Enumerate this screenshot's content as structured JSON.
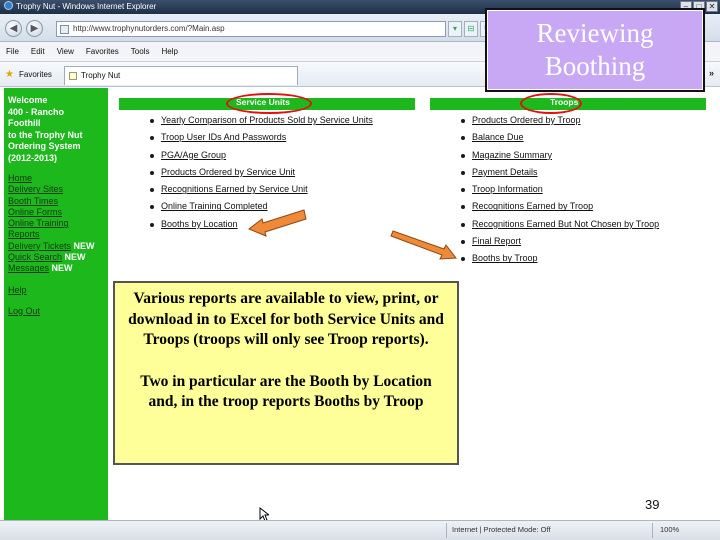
{
  "browser": {
    "window_title": "Trophy Nut - Windows Internet Explorer",
    "url": "http://www.trophynutorders.com/?Main.asp",
    "menu": [
      "File",
      "Edit",
      "View",
      "Favorites",
      "Tools",
      "Help"
    ],
    "favorites_label": "Favorites",
    "tab_title": "Trophy Nut",
    "status_zone": "Internet | Protected Mode: Off",
    "zoom": "100%"
  },
  "sidebar": {
    "welcome_lines": [
      "Welcome",
      "400 - Rancho",
      "Foothill",
      "to the Trophy Nut",
      "Ordering System",
      "(2012-2013)"
    ],
    "links": [
      "Home",
      "Delivery Sites",
      "Booth Times",
      "Online Forms",
      "Online Training",
      "Reports",
      "Delivery Tickets",
      "Quick Search",
      "Messages",
      "Help",
      "Log Out"
    ],
    "new_badge": "NEW"
  },
  "service_units": {
    "title": "Service Units",
    "reports": [
      "Yearly Comparison of Products Sold by Service Units",
      "Troop User IDs And Passwords",
      "PGA/Age Group",
      "Products Ordered by Service Unit",
      "Recognitions Earned by Service Unit",
      "Online Training Completed",
      "Booths by Location"
    ]
  },
  "troops": {
    "title": "Troops",
    "reports": [
      "Products Ordered by Troop",
      "Balance Due",
      "Magazine Summary",
      "Payment Details",
      "Troop Information",
      "Recognitions Earned by Troop",
      "Recognitions Earned But Not Chosen by Troop",
      "Final Report",
      "Booths by Troop"
    ]
  },
  "slide": {
    "title_line1": "Reviewing",
    "title_line2": "Boothing",
    "note_para1": "Various reports are available to view, print, or download in to Excel for both Service Units and Troops (troops will only see Troop reports).",
    "note_para2": "Two in particular are the Booth by Location and, in the troop reports Booths by Troop",
    "page_number": "39",
    "title_box_color": "#c8a8f4",
    "note_box_color": "#ffff99",
    "arrow_color": "#f08a38",
    "highlight_color": "#e31010"
  }
}
